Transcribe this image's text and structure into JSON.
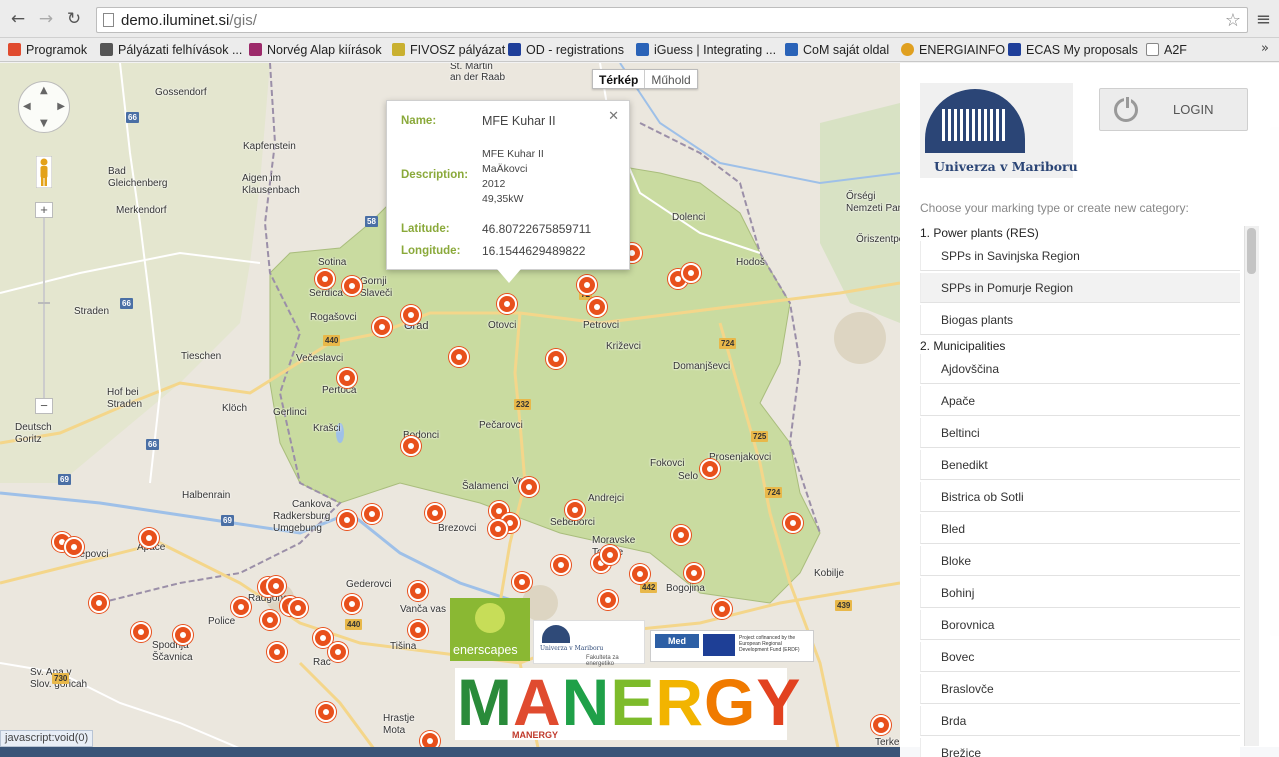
{
  "browser": {
    "url_host": "demo.iluminet.si",
    "url_path": "/gis/",
    "nav": {
      "back_icon": "back-arrow-icon",
      "forward_icon": "forward-arrow-icon",
      "reload_icon": "reload-icon"
    },
    "bookmarks": [
      {
        "label": "Programok",
        "color": "#e04b2f"
      },
      {
        "label": "Pályázati felhívások ...",
        "color": "#555555"
      },
      {
        "label": "Norvég Alap kiírások",
        "color": "#9c2a6a"
      },
      {
        "label": "FIVOSZ pályázat",
        "color": "#c9b030"
      },
      {
        "label": "OD - registrations",
        "color": "#1f3f9a"
      },
      {
        "label": "iGuess | Integrating ...",
        "color": "#2a63b8"
      },
      {
        "label": "CoM saját oldal",
        "color": "#2a63b8"
      },
      {
        "label": "ENERGIAINFO",
        "color": "#e0a020"
      },
      {
        "label": "ECAS My proposals",
        "color": "#1f3f9a"
      },
      {
        "label": "A2F",
        "color": "#888888"
      }
    ]
  },
  "map": {
    "type_controls": {
      "map": "Térkép",
      "satellite": "Műhold"
    },
    "labels": {
      "gossendorf": "Gossendorf",
      "st_martin": "St. Martin\nan der Raab",
      "bad_gleichenberg": "Bad\nGleichenberg",
      "merkendorf": "Merkendorf",
      "kapfenstein": "Kapfenstein",
      "klausenbach": "Aigen im\nKlausenbach",
      "sotina": "Sotina",
      "serdica": "Serdica",
      "gornji_slaveci": "Gornji\nSlaveči",
      "rogasovci": "Rogašovci",
      "grad": "Grad",
      "otovci": "Otovci",
      "petrovci": "Petrovci",
      "krizevci": "Križevci",
      "dolenci": "Dolenci",
      "hodos": "Hodoš",
      "orseg": "Őrségi\nNemzeti Park",
      "oriszentpeter": "Őriszentpéter",
      "straden": "Straden",
      "tieschen": "Tieschen",
      "vecaslavci": "Večeslavci",
      "pertoca": "Pertoca",
      "domanjsevci": "Domanjševci",
      "hof_bei_straden": "Hof bei\nStraden",
      "klöch": "Klöch",
      "gerlinci": "Gerlinci",
      "krasci": "Krašci",
      "pecarovci": "Pečarovci",
      "bodonci": "Bodonci",
      "deutsch_goritz": "Deutsch\nGoritz",
      "fokovci": "Fokovci",
      "prosenjakovci": "Prosenjakovci",
      "halbenrain": "Halbenrain",
      "salamenci": "Šalamenci",
      "andrejci": "Andrejci",
      "cankova": "Cankova",
      "radkersburg": "Radkersburg\nUmgebung",
      "brezovci": "Brezovci",
      "sebeborci": "Sebeborci",
      "apace": "Apače",
      "lepovci": "Lepovci",
      "radgona": "Radgona",
      "police": "Police",
      "vanca_vas": "Vanča vas",
      "tisina": "Tišina",
      "moravske_toplice": "Moravske\nToplice",
      "bogojina": "Bogojina",
      "kobilje": "Kobilje",
      "spodnja_scavnica": "Spodnja\nŠčavnica",
      "sv_ana": "Sv. Ana v\nSlov. goricah",
      "hrastje_mota": "Hrastje\nMota",
      "selo": "Selo",
      "terke": "Terke",
      "veca": "Veča",
      "rac": "Rac",
      "gederovci": "Gederovci"
    },
    "infowindow": {
      "name_label": "Name:",
      "name_value": "MFE Kuhar II",
      "description_label": "Description:",
      "description_lines": [
        "MFE Kuhar II",
        "MaÄkovci",
        "2012",
        "49,35kW"
      ],
      "latitude_label": "Latitude:",
      "latitude_value": "46.80722675859711",
      "longitude_label": "Longitude:",
      "longitude_value": "16.1544629489822"
    },
    "road_numbers": [
      "66",
      "58",
      "66",
      "440",
      "66",
      "69",
      "69",
      "232",
      "724",
      "725",
      "724",
      "442",
      "440",
      "439",
      "730",
      "72"
    ],
    "logos": {
      "enerscapes": "enerscapes",
      "unimb_small": "Univerza v Mariboru",
      "unimb_small_sub": "Fakulteta za energetiko",
      "med_label": "Med",
      "med_text": "Project cofinanced by the European Regional Development Fund (ERDF)",
      "manergy_word": "MANERGY",
      "manergy_sub": "MANERGY",
      "manergy_colors": [
        "#2a8b3a",
        "#e04b2f",
        "#1fa048",
        "#7dbb2b",
        "#f2b400",
        "#f07a00",
        "#e24220"
      ]
    }
  },
  "status": {
    "text": "javascript:void(0)"
  },
  "panel": {
    "logo_name": "Univerza v Mariboru",
    "login_label": "LOGIN",
    "prompt": "Choose your marking type or create new category:",
    "categories": [
      {
        "title": "1. Power plants (RES)",
        "items": [
          "SPPs in Savinjska Region",
          "SPPs in Pomurje Region",
          "Biogas plants"
        ]
      },
      {
        "title": "2. Municipalities",
        "items": [
          "Ajdovščina",
          "Apače",
          "Beltinci",
          "Benedikt",
          "Bistrica ob Sotli",
          "Bled",
          "Bloke",
          "Bohinj",
          "Borovnica",
          "Bovec",
          "Braslovče",
          "Brda",
          "Brežice"
        ]
      }
    ]
  }
}
